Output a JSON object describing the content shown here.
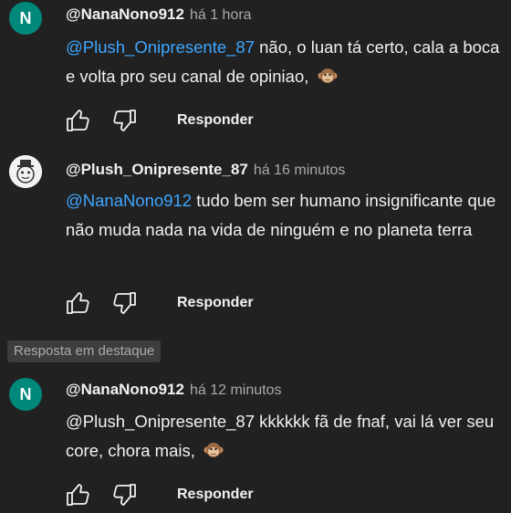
{
  "comments": [
    {
      "avatar_letter": "N",
      "author": "@NanaNono912",
      "time": "há 1 hora",
      "mention": "@Plush_Onipresente_87",
      "text_rest": "não, o luan tá certo, cala a boca e volta pro seu canal de opiniao,",
      "emoji": "monkey-emoji",
      "reply_label": "Responder"
    },
    {
      "avatar_letter": "",
      "author": "@Plush_Onipresente_87",
      "time": "há 16 minutos",
      "mention": "@NanaNono912",
      "text_rest": "tudo bem ser humano insignificante que não muda nada na vida de ninguém e no planeta terra",
      "reply_label": "Responder"
    },
    {
      "avatar_letter": "N",
      "author": "@NanaNono912",
      "time": "há 12 minutos",
      "mention": "@Plush_Onipresente_87",
      "text_rest": "kkkkkk fã de fnaf, vai lá ver seu core, chora mais,",
      "emoji": "monkey-emoji",
      "reply_label": "Responder"
    }
  ],
  "pinned_label": "Resposta em destaque",
  "colors": {
    "background": "#212121",
    "mention": "#3ea6ff",
    "avatar_n": "#00897b",
    "secondary_text": "#aaaaaa"
  },
  "icons": [
    "thumbs-up-icon",
    "thumbs-down-icon",
    "monkey-emoji"
  ]
}
